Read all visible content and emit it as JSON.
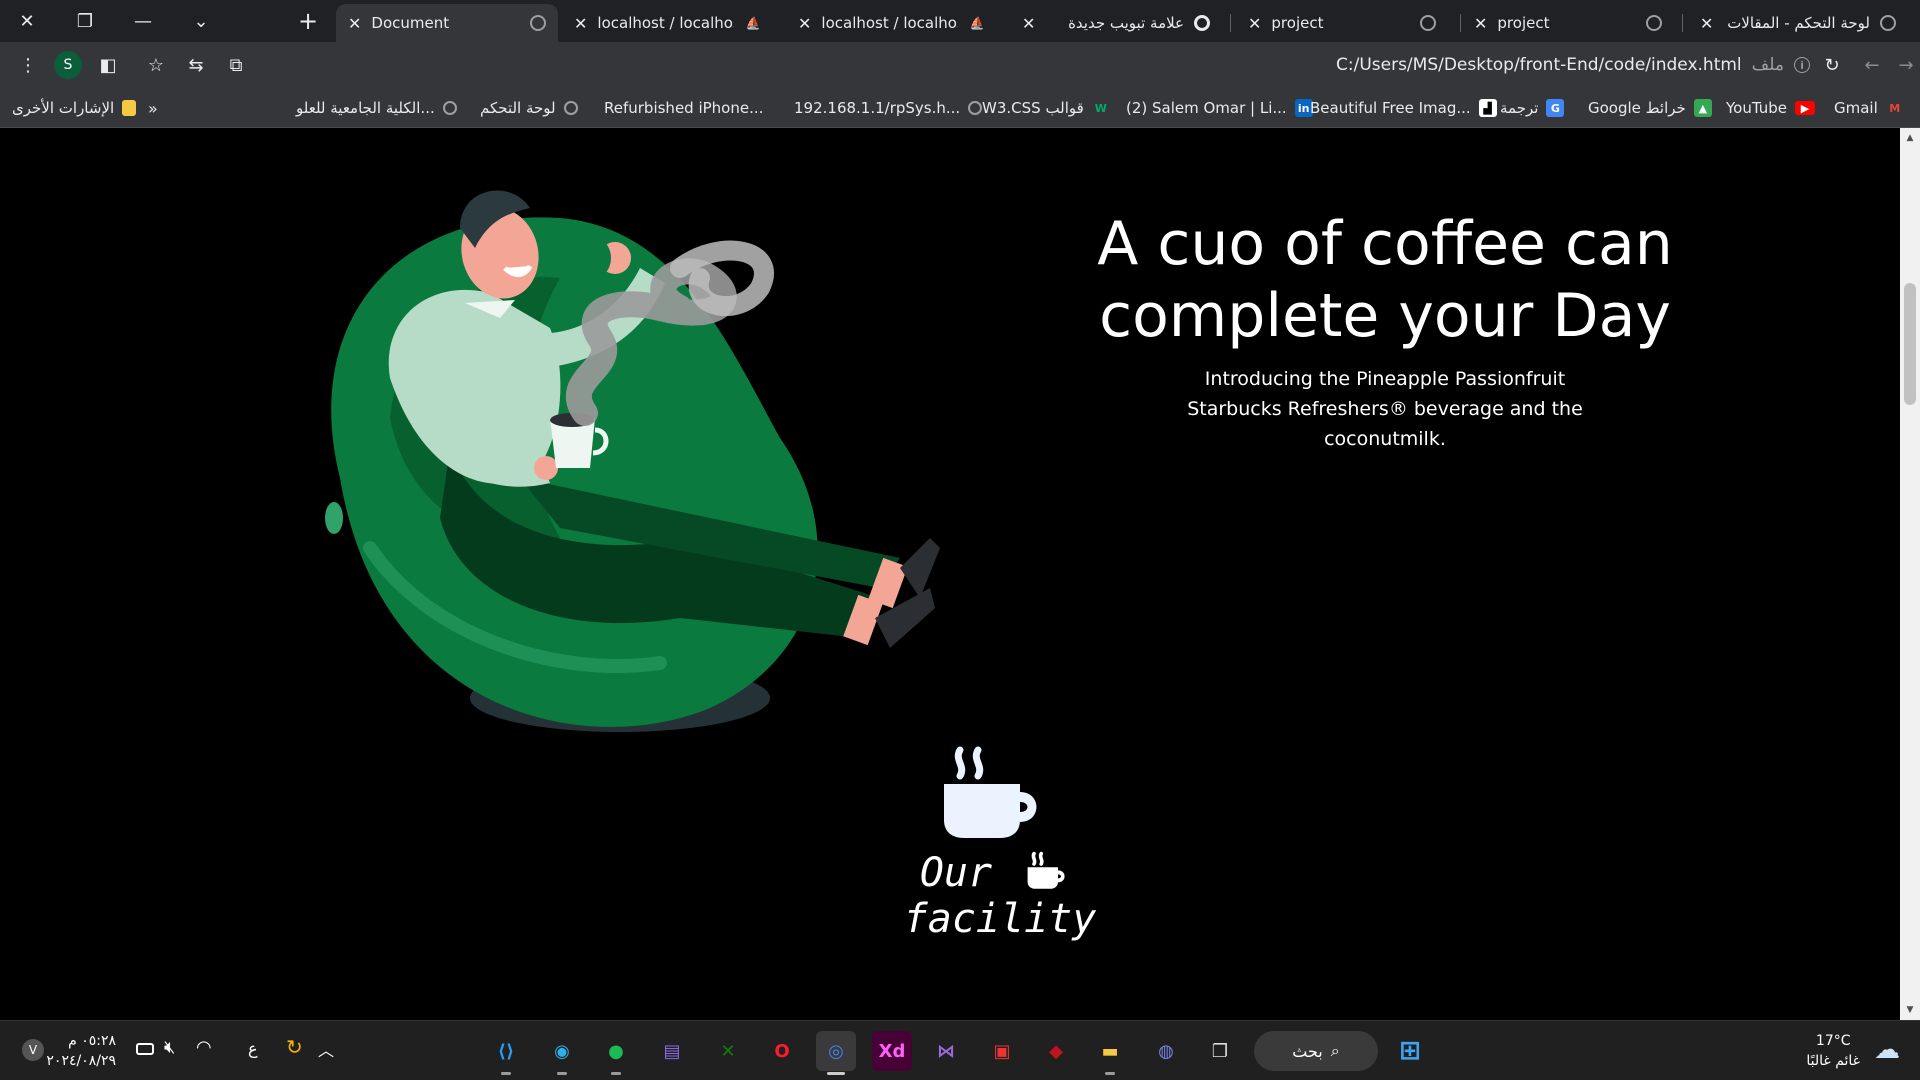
{
  "window_controls": {
    "close": "✕",
    "restore": "❐",
    "minimize": "—",
    "list": "⌄"
  },
  "tabs": [
    {
      "title": "Document",
      "active": true,
      "icon": "globe-icon"
    },
    {
      "title": "localhost / localhost |",
      "active": false,
      "icon": "phpmyadmin-icon"
    },
    {
      "title": "localhost / localhost /",
      "active": false,
      "icon": "phpmyadmin-icon"
    },
    {
      "title": "علامة تبويب جديدة",
      "active": false,
      "icon": "chrome-icon"
    },
    {
      "title": "project",
      "active": false,
      "icon": "globe-icon"
    },
    {
      "title": "project",
      "active": false,
      "icon": "globe-icon"
    },
    {
      "title": "لوحة التحكم - المقالات",
      "active": false,
      "icon": "globe-icon"
    }
  ],
  "new_tab": "+",
  "toolbar": {
    "profile_initial": "S",
    "url": "C:/Users/MS/Desktop/front-End/code/index.html",
    "file_label": "ملف"
  },
  "bookmarks": {
    "other_bookmarks": "الإشارات الأخرى",
    "overflow": "»",
    "items": [
      {
        "label": "الكلية الجامعية للعلو...",
        "icon": "globe-icon"
      },
      {
        "label": "لوحة التحكم",
        "icon": "globe-icon"
      },
      {
        "label": "Refurbished iPhone...",
        "icon": "apple-icon"
      },
      {
        "label": "192.168.1.1/rpSys.h...",
        "icon": "globe-icon"
      },
      {
        "label": "W3.CSS قوالب",
        "icon": "w3-icon"
      },
      {
        "label": "(2) Salem Omar | Li...",
        "icon": "linkedin-icon"
      },
      {
        "label": "Beautiful Free Imag...",
        "icon": "unsplash-icon"
      },
      {
        "label": "ترجمة",
        "icon": "translate-icon"
      },
      {
        "label": "Google خرائط",
        "icon": "maps-icon"
      },
      {
        "label": "YouTube",
        "icon": "youtube-icon"
      },
      {
        "label": "Gmail",
        "icon": "gmail-icon"
      }
    ]
  },
  "hero": {
    "title": "A cuo of coffee can complete your Day",
    "subtitle": "Introducing the Pineapple Passionfruit Starbucks Refreshers® beverage and the coconutmilk."
  },
  "facility": {
    "word1": "Our",
    "word2": "facility"
  },
  "taskbar": {
    "time": "٠٥:٢٨ م",
    "date": "٢٠٢٤/٠٨/٢٩",
    "lang": "ع",
    "search": "بحث",
    "temperature": "17°C",
    "weather": "غائم غالبًا",
    "apps": [
      "vscode-icon",
      "edge-icon",
      "spotify-icon",
      "clapper-icon",
      "xbox-icon",
      "opera-icon",
      "chrome-icon",
      "xd-icon",
      "visual-studio-icon",
      "app-icon",
      "app-icon-red",
      "file-explorer-icon",
      "teams-icon",
      "task-view-icon"
    ],
    "colors": {
      "vscode": "#2b9af3",
      "spotify": "#1db954",
      "xbox": "#107c10",
      "opera": "#ff1b2d",
      "xd": "#ff61f6"
    }
  },
  "colors": {
    "chair_green": "#0b7a3e",
    "chair_dark": "#06552b",
    "shirt": "#b6dcc8",
    "pants": "#053b1d",
    "skin": "#f4a696"
  }
}
